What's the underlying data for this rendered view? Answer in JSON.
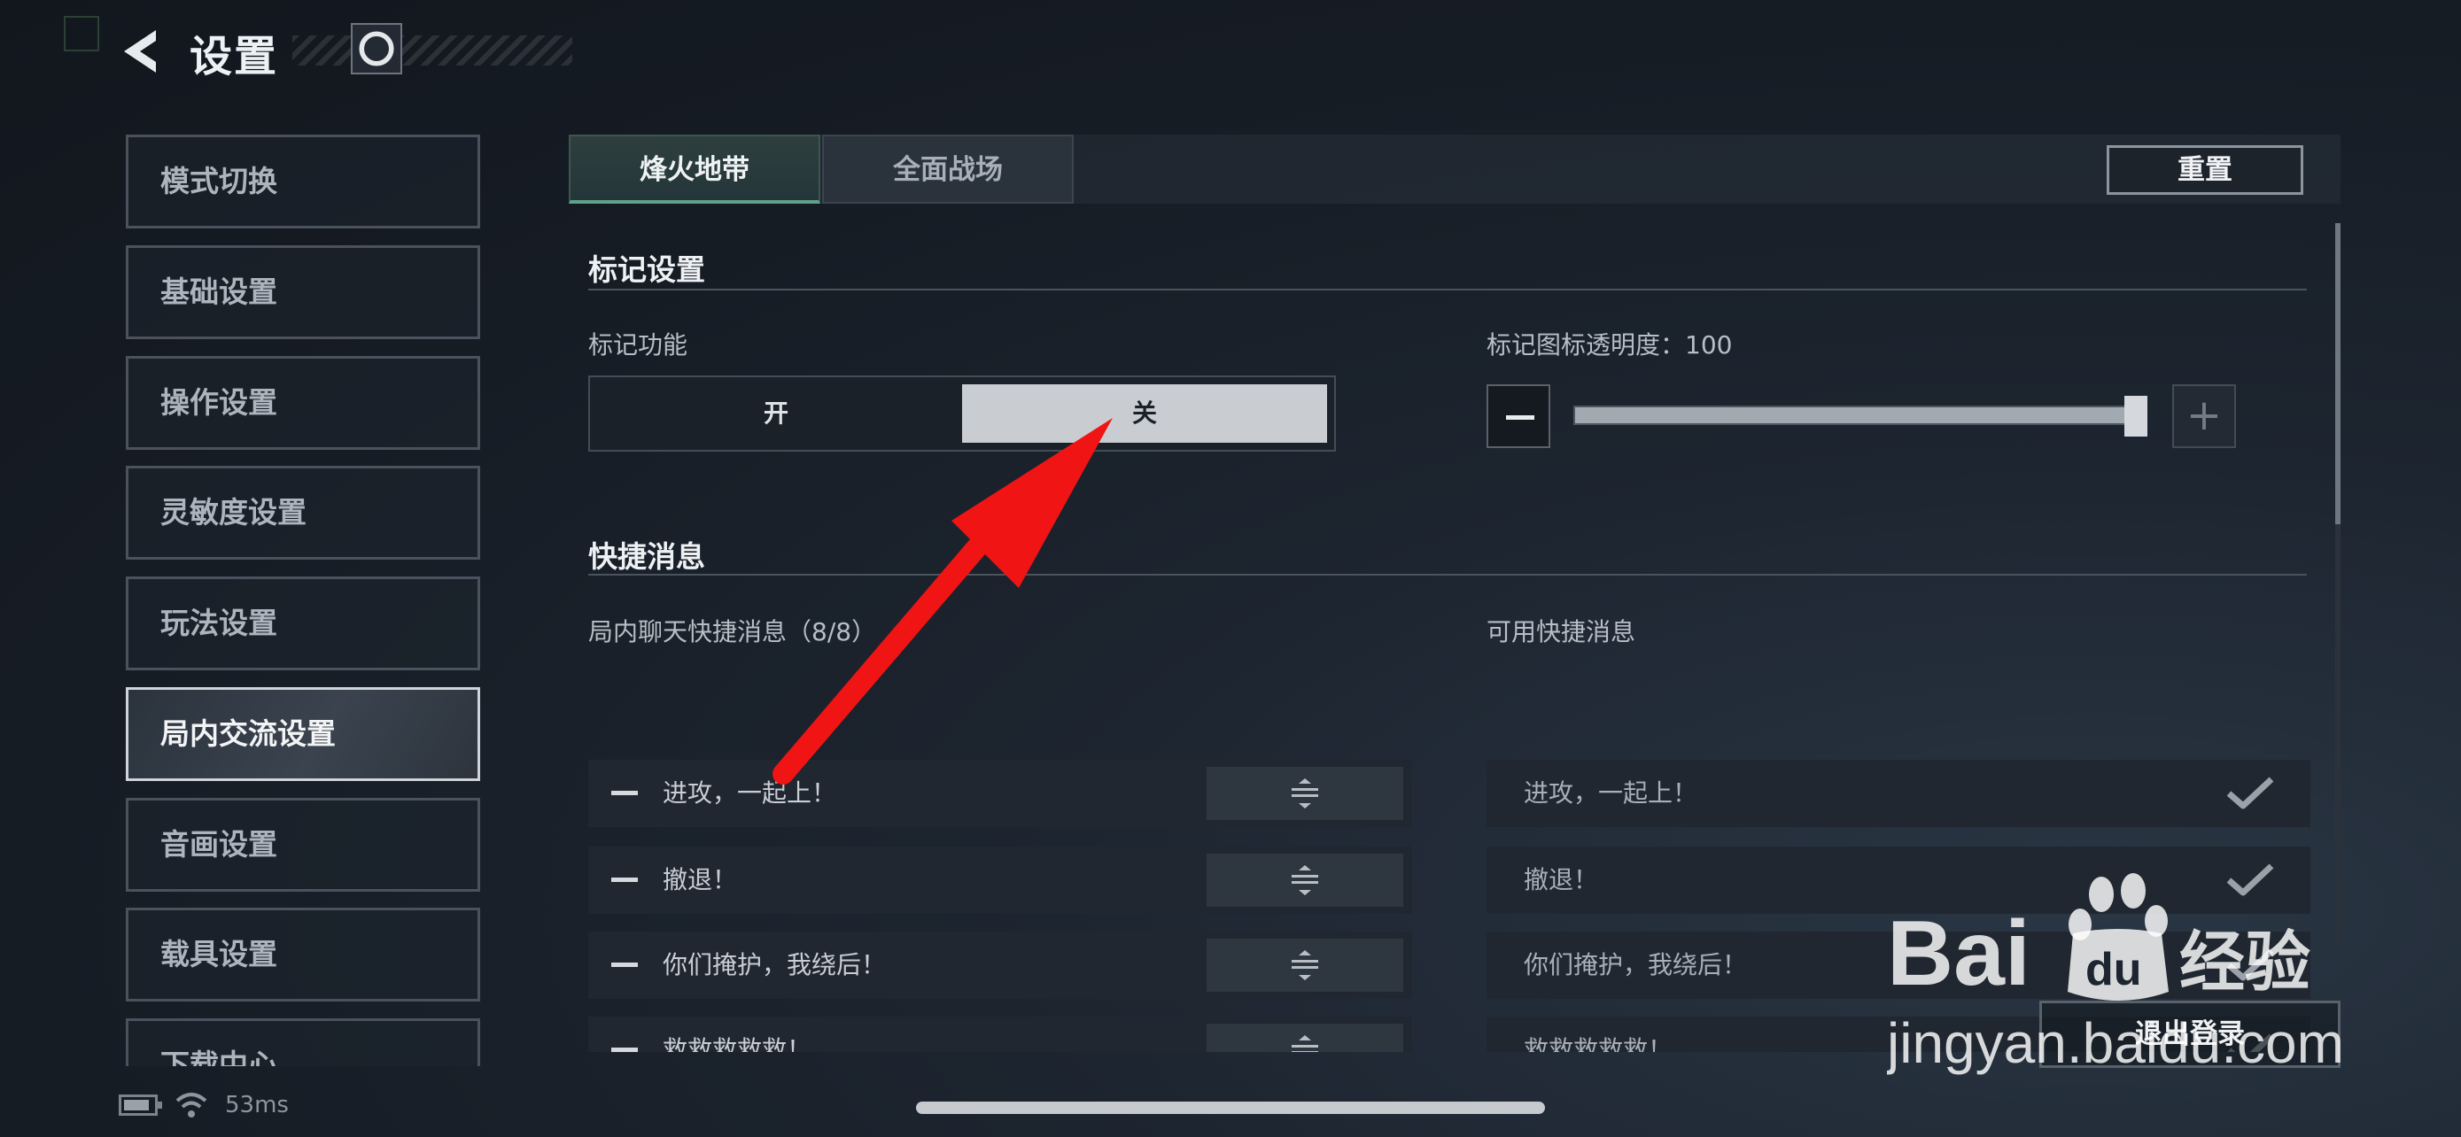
{
  "header": {
    "title": "设置",
    "back_icon": "back-arrow-icon",
    "game_icon": "game-logo-icon"
  },
  "sidebar": {
    "items": [
      {
        "label": "模式切换"
      },
      {
        "label": "基础设置"
      },
      {
        "label": "操作设置"
      },
      {
        "label": "灵敏度设置"
      },
      {
        "label": "玩法设置"
      },
      {
        "label": "局内交流设置",
        "active": true
      },
      {
        "label": "音画设置"
      },
      {
        "label": "载具设置"
      },
      {
        "label": "下载中心"
      }
    ]
  },
  "tabs": [
    {
      "label": "烽火地带",
      "active": true
    },
    {
      "label": "全面战场"
    }
  ],
  "reset_label": "重置",
  "marker_section": {
    "title": "标记设置",
    "feature_label": "标记功能",
    "toggle_on": "开",
    "toggle_off": "关",
    "toggle_selected": "关",
    "opacity_label": "标记图标透明度：100",
    "opacity_value": 100
  },
  "quick_section": {
    "title": "快捷消息",
    "left_label": "局内聊天快捷消息（8/8）",
    "right_label": "可用快捷消息",
    "selected": [
      "进攻，一起上！",
      "撤退！",
      "你们掩护，我绕后！",
      "救救救救救！"
    ],
    "available": [
      "进攻，一起上！",
      "撤退！",
      "你们掩护，我绕后！",
      "救救救救救！"
    ]
  },
  "logout_label": "退出登录",
  "status": {
    "ping": "53ms",
    "icons": [
      "battery-icon",
      "wifi-icon"
    ]
  },
  "watermark": {
    "brand": "Bai",
    "brand2": "du",
    "suffix": "经验",
    "url": "jingyan.baidu.com"
  },
  "colors": {
    "accent": "#5fa28c",
    "arrow": "#f01414",
    "toggle_selected_bg": "#c9cdd2"
  }
}
